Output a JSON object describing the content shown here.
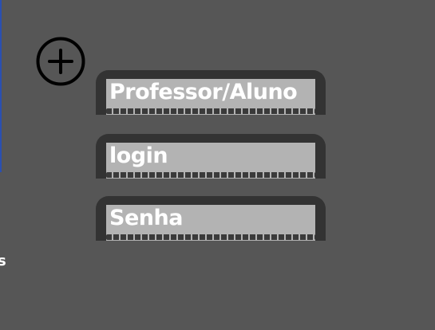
{
  "icons": {
    "add": "plus-circle-icon"
  },
  "colors": {
    "background": "#565656",
    "field_frame": "#333333",
    "field_fill": "#b3b3b3",
    "label_text": "#ffffff",
    "icon_stroke": "#000000"
  },
  "form": {
    "role_label": "Professor/Aluno",
    "login_label": "login",
    "password_label": "Senha"
  },
  "edge": {
    "glyph": "s"
  }
}
